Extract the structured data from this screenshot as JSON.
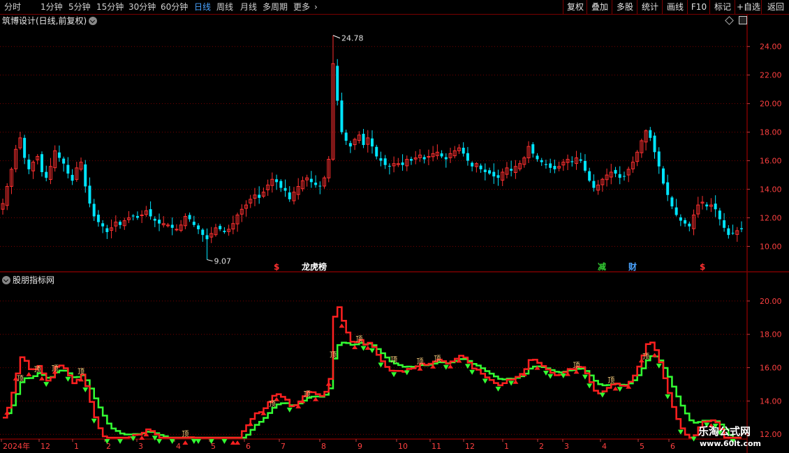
{
  "toolbar": {
    "periods": [
      "分时",
      "1分钟",
      "5分钟",
      "15分钟",
      "30分钟",
      "60分钟",
      "日线",
      "周线",
      "月线",
      "多周期",
      "更多"
    ],
    "active_period": "日线",
    "more_arrow": "›",
    "buttons": [
      "复权",
      "叠加",
      "多股",
      "统计",
      "画线",
      "F10",
      "标记",
      "+自选",
      "返回"
    ]
  },
  "main_panel": {
    "title": "筑博设计(日线,前复权)",
    "high_label": "24.78",
    "low_label": "9.07",
    "price_axis": [
      "24.00",
      "22.00",
      "20.00",
      "18.00",
      "16.00",
      "14.00",
      "12.00",
      "10.00"
    ],
    "event_markers": [
      {
        "text": "$",
        "color": "#ff3030"
      },
      {
        "text": "龙虎榜",
        "color": "#ffffff"
      },
      {
        "text": "减",
        "color": "#33cc33"
      },
      {
        "text": "财",
        "color": "#4aa3ff"
      },
      {
        "text": "$",
        "color": "#ff3030"
      }
    ]
  },
  "indicator_panel": {
    "title": "股朋指标网",
    "axis": [
      "20.00",
      "18.00",
      "16.00",
      "14.00",
      "12.00"
    ],
    "signal_label": "顶"
  },
  "time_axis": {
    "start": "2024年",
    "labels": [
      "12",
      "1",
      "2",
      "3",
      "4",
      "5",
      "6",
      "7",
      "8",
      "9",
      "10",
      "11",
      "12",
      "1",
      "2",
      "3",
      "4",
      "5",
      "6"
    ]
  },
  "watermark": {
    "name": "乐淘公式网",
    "url": "www.60lt.com"
  },
  "colors": {
    "up": "#ff3030",
    "down": "#00e5ff",
    "fast": "#ff2020",
    "slow": "#33ff33",
    "grid": "#7a0000"
  },
  "chart_data": {
    "type": "candlestick",
    "x_axis_type": "time",
    "ylim": [
      9.0,
      25.5
    ],
    "close": [
      13.0,
      14.2,
      15.4,
      16.8,
      17.6,
      16.2,
      15.4,
      15.9,
      16.3,
      15.2,
      14.8,
      15.6,
      16.7,
      16.2,
      15.8,
      15.1,
      14.6,
      15.5,
      15.9,
      14.2,
      13.0,
      12.1,
      11.7,
      11.4,
      11.0,
      11.3,
      11.7,
      11.5,
      11.8,
      12.0,
      12.1,
      12.0,
      12.2,
      12.5,
      12.1,
      11.8,
      11.6,
      11.6,
      11.5,
      11.3,
      11.2,
      11.5,
      12.1,
      11.9,
      11.5,
      11.2,
      10.8,
      10.5,
      10.9,
      11.3,
      11.2,
      11.0,
      11.2,
      11.6,
      12.2,
      12.6,
      12.9,
      13.3,
      13.6,
      13.4,
      13.8,
      14.3,
      14.7,
      14.5,
      14.1,
      13.9,
      13.3,
      13.8,
      14.2,
      14.6,
      14.8,
      14.5,
      14.3,
      14.2,
      14.8,
      16.1,
      22.8,
      20.2,
      18.0,
      17.4,
      17.0,
      17.5,
      17.8,
      17.1,
      17.6,
      17.0,
      16.3,
      16.0,
      15.7,
      15.6,
      15.8,
      15.8,
      15.7,
      16.1,
      16.0,
      16.2,
      16.4,
      16.1,
      16.3,
      16.5,
      16.6,
      16.3,
      16.1,
      16.5,
      16.7,
      16.9,
      16.5,
      16.0,
      15.6,
      15.8,
      15.4,
      15.2,
      15.1,
      14.9,
      14.8,
      15.2,
      15.5,
      15.3,
      15.6,
      15.8,
      16.2,
      17.0,
      16.5,
      16.1,
      15.9,
      15.7,
      15.5,
      15.4,
      15.6,
      15.9,
      16.1,
      15.9,
      16.2,
      16.0,
      15.3,
      14.6,
      14.1,
      14.3,
      14.7,
      15.0,
      15.2,
      15.1,
      14.8,
      14.9,
      15.4,
      15.9,
      16.6,
      17.4,
      18.1,
      17.6,
      16.6,
      15.6,
      14.4,
      13.6,
      12.8,
      12.2,
      11.8,
      11.6,
      11.4,
      12.2,
      12.9,
      13.1,
      12.8,
      12.9,
      12.6,
      11.9,
      11.3,
      10.8,
      10.9,
      11.1,
      11.2
    ],
    "high_annotation": 24.78,
    "low_annotation": 9.07,
    "indicator_series": [
      {
        "name": "",
        "type": "line",
        "color": "#ff2020",
        "source": "close",
        "smoothing": "ema3"
      },
      {
        "name": "",
        "type": "line",
        "color": "#33ff33",
        "source": "close",
        "smoothing": "ema8"
      }
    ],
    "indicator_ylim": [
      11.8,
      21.0
    ]
  }
}
